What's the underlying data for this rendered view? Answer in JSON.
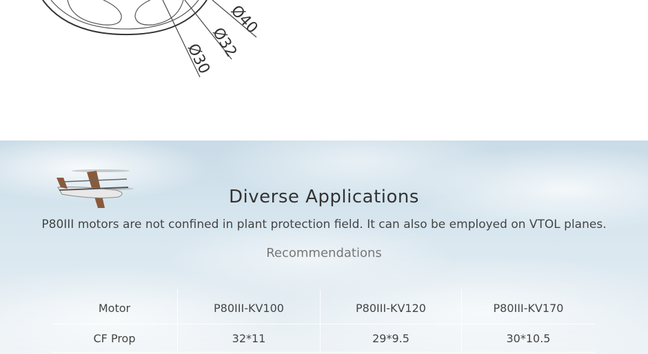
{
  "diagram": {
    "dimension_labels": [
      "Ø40",
      "Ø32",
      "Ø30"
    ]
  },
  "applications": {
    "title": "Diverse Applications",
    "description": "P80III motors are not confined in plant protection field. It can also be employed on VTOL planes.",
    "recommendations_label": "Recommendations",
    "plane_image": "vtol-plane-illustration"
  },
  "spec_table": {
    "columns": [
      "Motor",
      "P80III-KV100",
      "P80III-KV120",
      "P80III-KV170"
    ],
    "rows": [
      {
        "label": "CF Prop",
        "values": [
          "32*11",
          "29*9.5",
          "30*10.5"
        ]
      }
    ]
  }
}
